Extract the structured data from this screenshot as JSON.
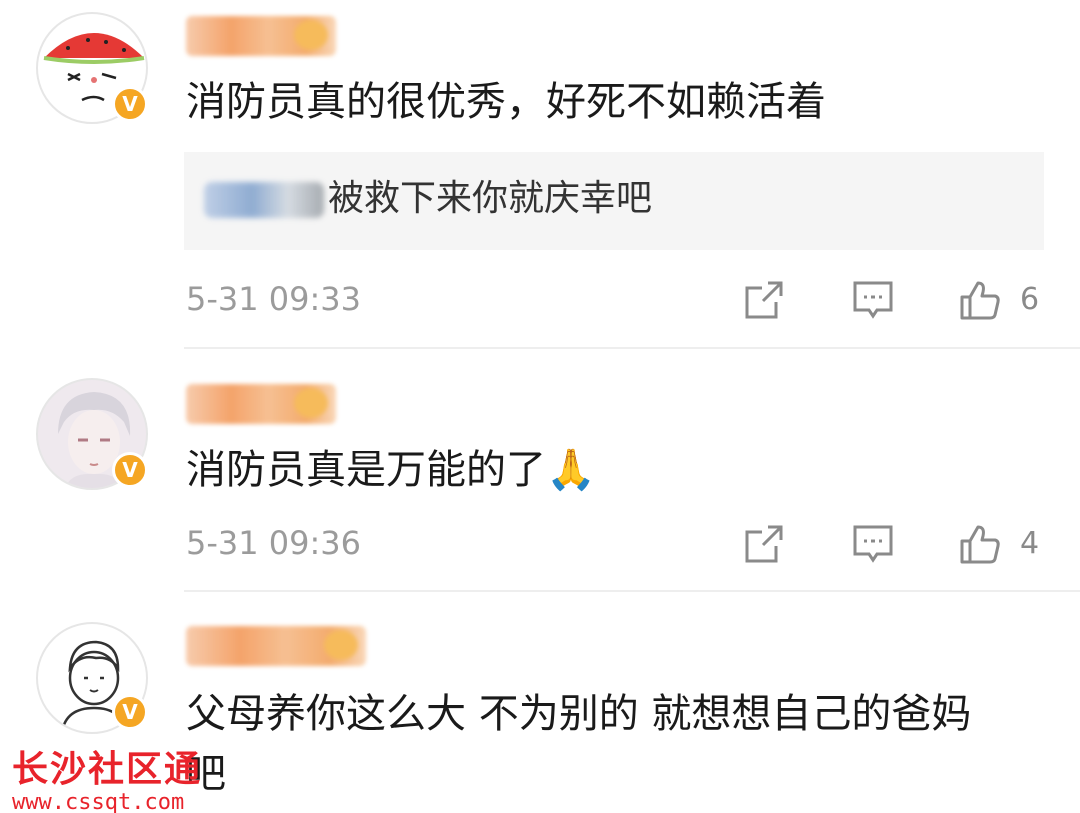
{
  "comments": [
    {
      "text": "消防员真的很优秀，好死不如赖活着",
      "reply": {
        "text": "被救下来你就庆幸吧"
      },
      "time": "5-31 09:33",
      "likes": "6"
    },
    {
      "text": "消防员真是万能的了🙏",
      "time": "5-31 09:36",
      "likes": "4"
    },
    {
      "text": "父母养你这么大 不为别的 就想想自己的爸妈",
      "text_cont": "吧"
    }
  ],
  "badge": "V",
  "watermark": {
    "title": "长沙社区通",
    "url": "www.cssqt.com"
  },
  "colors": {
    "badge": "#f5a623",
    "watermark": "#e8232b",
    "meta": "#9b9b9b"
  },
  "icons": [
    "share-icon",
    "comment-icon",
    "like-icon"
  ]
}
